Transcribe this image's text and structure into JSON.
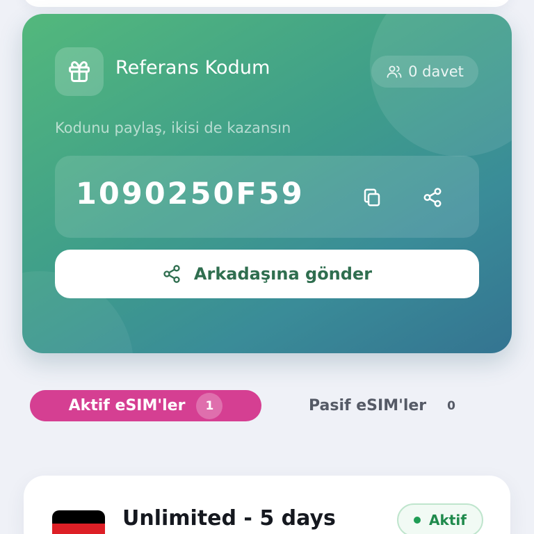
{
  "referral": {
    "title": "Referans Kodum",
    "invite_count": "0 davet",
    "subtitle": "Kodunu paylaş, ikisi de kazansın",
    "code": "1090250F59",
    "send_button_label": "Arkadaşına gönder"
  },
  "tabs": [
    {
      "label": "Aktif eSIM'ler",
      "count": "1",
      "active": true
    },
    {
      "label": "Pasif eSIM'ler",
      "count": "0",
      "active": false
    }
  ],
  "esim_card": {
    "plan_title": "Unlimited - 5 days",
    "status": "Aktif",
    "flag_icon": "germany-flag-icon",
    "flag_colors": [
      "#000000",
      "#dd1f26",
      "#ffce00"
    ]
  },
  "colors": {
    "card_gradient_start": "#53b87c",
    "card_gradient_end": "#347491",
    "active_tab": "#d53f92",
    "status_green": "#1f8a4c"
  }
}
